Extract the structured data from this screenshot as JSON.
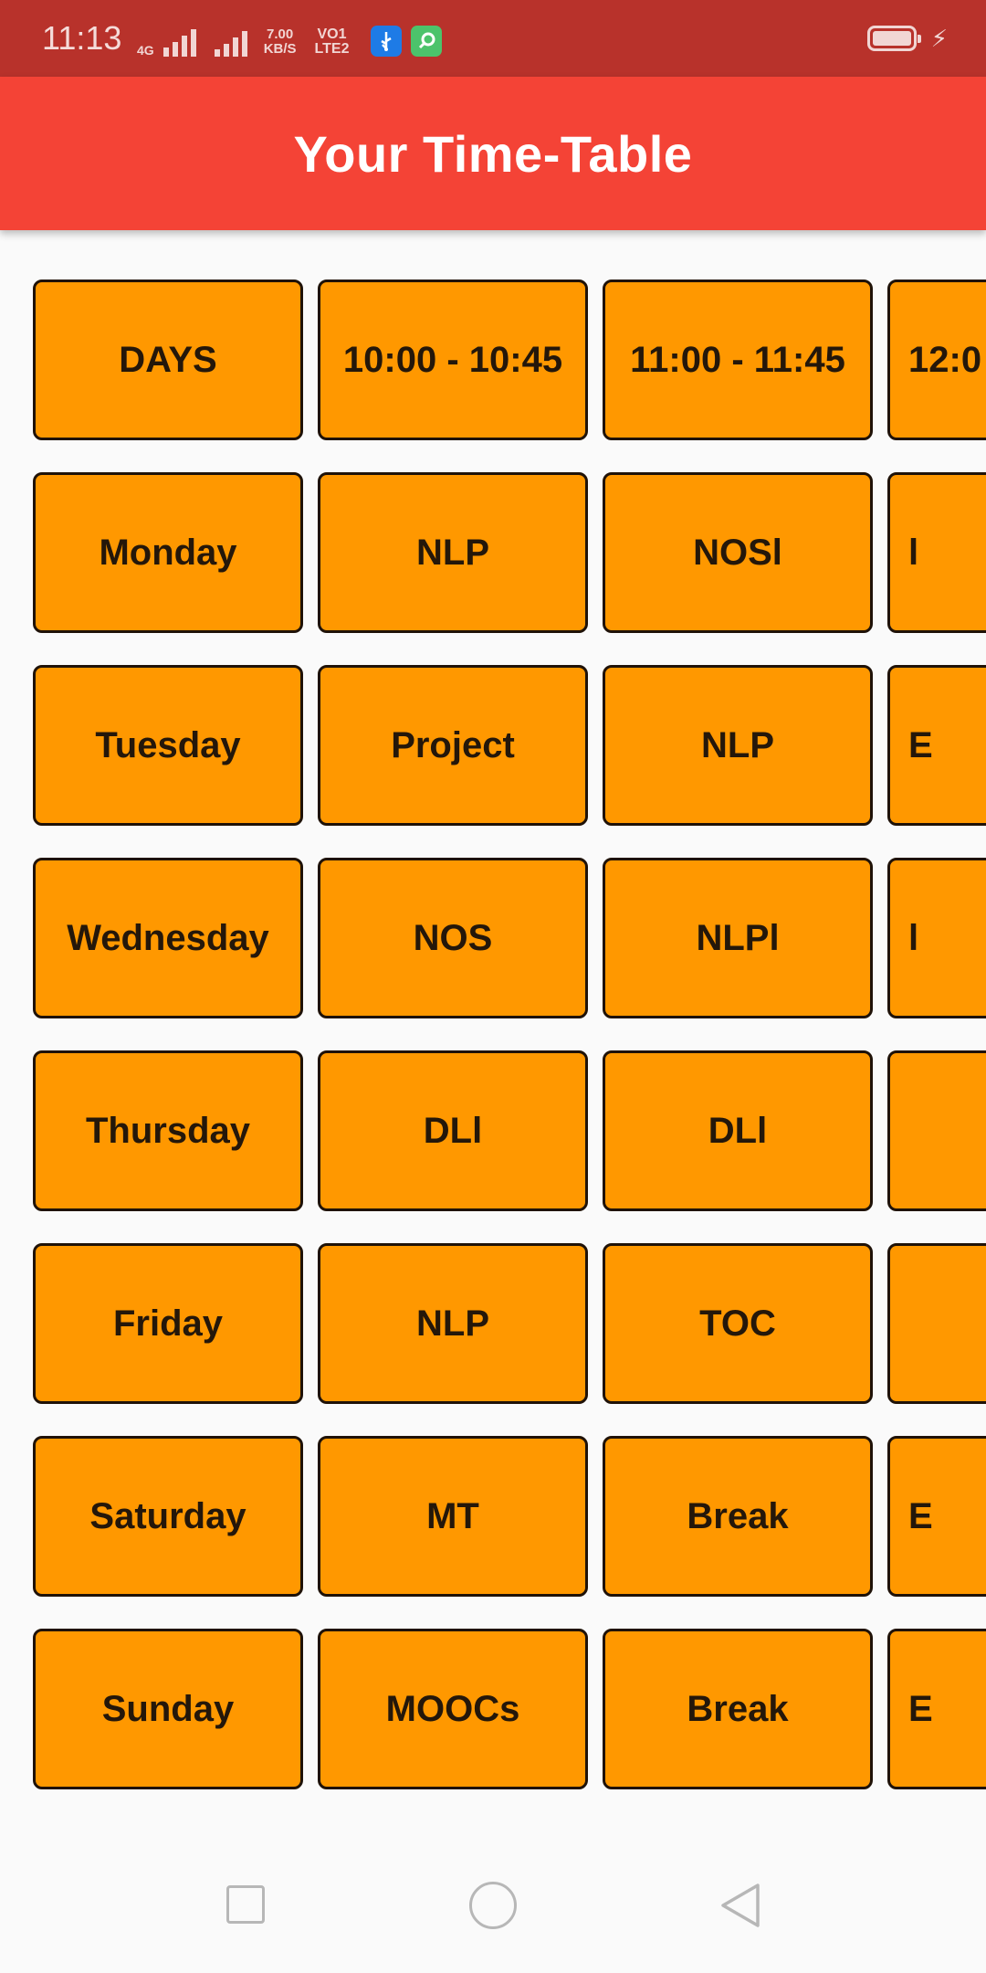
{
  "status_bar": {
    "time": "11:13",
    "network_type": "4G",
    "speed_value": "7.00",
    "speed_unit": "KB/S",
    "volte_top": "VO",
    "volte_bottom": "LTE",
    "sim_1": "1",
    "sim_2": "2",
    "icons": [
      "signal-icon",
      "signal-icon",
      "usb-icon",
      "app-notification-icon",
      "battery-icon",
      "charging-bolt-icon"
    ]
  },
  "app_bar": {
    "title": "Your Time-Table"
  },
  "timetable": {
    "headers": [
      "DAYS",
      "10:00 - 10:45",
      "11:00 - 11:45",
      "12:0"
    ],
    "rows": [
      {
        "day": "Monday",
        "cells": [
          "NLP",
          "NOSl",
          "l"
        ]
      },
      {
        "day": "Tuesday",
        "cells": [
          "Project",
          "NLP",
          "E"
        ]
      },
      {
        "day": "Wednesday",
        "cells": [
          "NOS",
          "NLPl",
          "l"
        ]
      },
      {
        "day": "Thursday",
        "cells": [
          "DLl",
          "DLl",
          ""
        ]
      },
      {
        "day": "Friday",
        "cells": [
          "NLP",
          "TOC",
          ""
        ]
      },
      {
        "day": "Saturday",
        "cells": [
          "MT",
          "Break",
          "E"
        ]
      },
      {
        "day": "Sunday",
        "cells": [
          "MOOCs",
          "Break",
          "E"
        ]
      }
    ]
  },
  "nav_bar": {
    "icons": [
      "recent-apps-icon",
      "home-icon",
      "back-icon"
    ]
  },
  "colors": {
    "status_bar": "#b8322b",
    "app_bar": "#f44336",
    "cell_fill": "#ff9800",
    "cell_border": "#1f1208",
    "background": "#fafafa"
  }
}
